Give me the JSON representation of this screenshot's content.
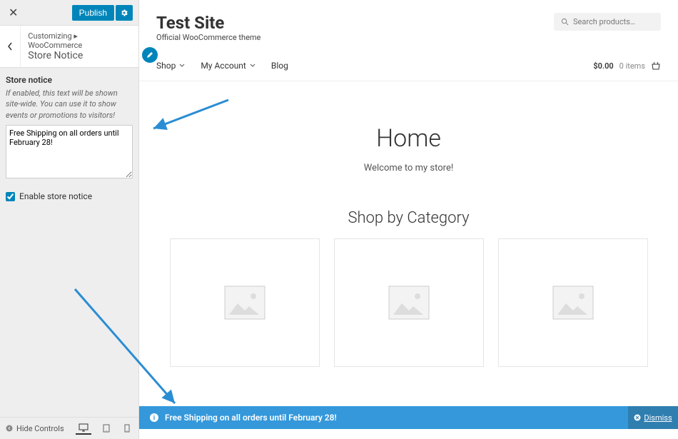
{
  "sidebar": {
    "publish_label": "Publish",
    "crumb_prefix": "Customizing ▸ WooCommerce",
    "crumb_title": "Store Notice",
    "section_heading": "Store notice",
    "section_desc": "If enabled, this text will be shown site-wide. You can use it to show events or promotions to visitors!",
    "notice_text": "Free Shipping on all orders until February 28!",
    "enable_label": "Enable store notice",
    "hide_controls_label": "Hide Controls"
  },
  "preview": {
    "site_title": "Test Site",
    "site_tagline": "Official WooCommerce theme",
    "search_placeholder": "Search products…",
    "nav": {
      "shop": "Shop",
      "account": "My Account",
      "blog": "Blog"
    },
    "cart": {
      "amount": "$0.00",
      "items": "0 items"
    },
    "home_heading": "Home",
    "home_sub": "Welcome to my store!",
    "shopcat_heading": "Shop by Category"
  },
  "notice_bar": {
    "text": "Free Shipping on all orders until February 28!",
    "dismiss": "Dismiss"
  }
}
